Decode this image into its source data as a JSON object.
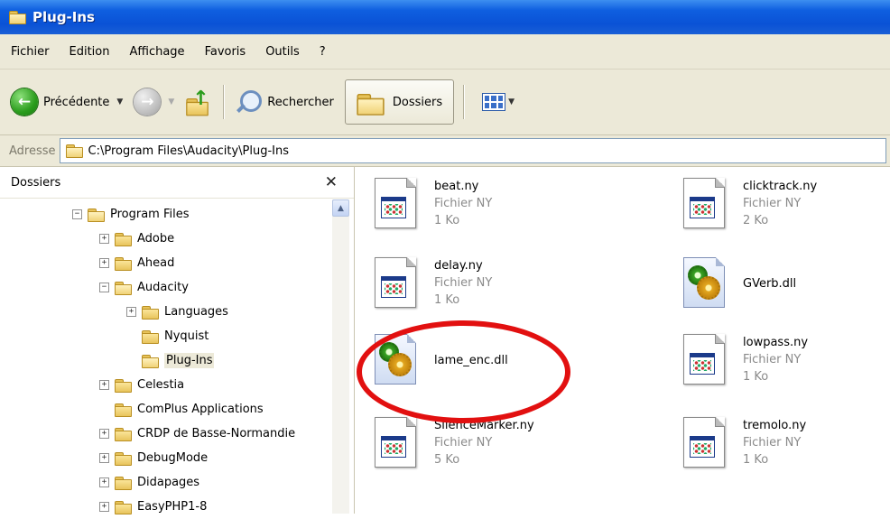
{
  "window": {
    "title": "Plug-Ins"
  },
  "menu": [
    "Fichier",
    "Edition",
    "Affichage",
    "Favoris",
    "Outils",
    "?"
  ],
  "toolbar": {
    "back_label": "Précédente",
    "search_label": "Rechercher",
    "folders_label": "Dossiers"
  },
  "address": {
    "label": "Adresse",
    "value": "C:\\Program Files\\Audacity\\Plug-Ins"
  },
  "folders_pane": {
    "title": "Dossiers",
    "items": [
      {
        "label": "Program Files",
        "expander": "⊟"
      },
      {
        "label": "Adobe",
        "expander": "⊞"
      },
      {
        "label": "Ahead",
        "expander": "⊞"
      },
      {
        "label": "Audacity",
        "expander": "⊟"
      },
      {
        "label": "Languages",
        "expander": "⊞"
      },
      {
        "label": "Nyquist",
        "expander": ""
      },
      {
        "label": "Plug-Ins",
        "expander": ""
      },
      {
        "label": "Celestia",
        "expander": "⊞"
      },
      {
        "label": "ComPlus Applications",
        "expander": ""
      },
      {
        "label": "CRDP de Basse-Normandie",
        "expander": "⊞"
      },
      {
        "label": "DebugMode",
        "expander": "⊞"
      },
      {
        "label": "Didapages",
        "expander": "⊞"
      },
      {
        "label": "EasyPHP1-8",
        "expander": "⊞"
      }
    ]
  },
  "files": [
    {
      "name": "beat.ny",
      "type": "Fichier NY",
      "size": "1 Ko",
      "icon": "ny-file-icon"
    },
    {
      "name": "clicktrack.ny",
      "type": "Fichier NY",
      "size": "2 Ko",
      "icon": "ny-file-icon"
    },
    {
      "name": "delay.ny",
      "type": "Fichier NY",
      "size": "1 Ko",
      "icon": "ny-file-icon"
    },
    {
      "name": "GVerb.dll",
      "type": "",
      "size": "",
      "icon": "dll-file-icon"
    },
    {
      "name": "lame_enc.dll",
      "type": "",
      "size": "",
      "icon": "dll-file-icon"
    },
    {
      "name": "lowpass.ny",
      "type": "Fichier NY",
      "size": "1 Ko",
      "icon": "ny-file-icon"
    },
    {
      "name": "SilenceMarker.ny",
      "type": "Fichier NY",
      "size": "5 Ko",
      "icon": "ny-file-icon"
    },
    {
      "name": "tremolo.ny",
      "type": "Fichier NY",
      "size": "1 Ko",
      "icon": "ny-file-icon"
    }
  ],
  "annotation": {
    "highlight_color": "#e21010",
    "highlighted_file": "lame_enc.dll"
  }
}
